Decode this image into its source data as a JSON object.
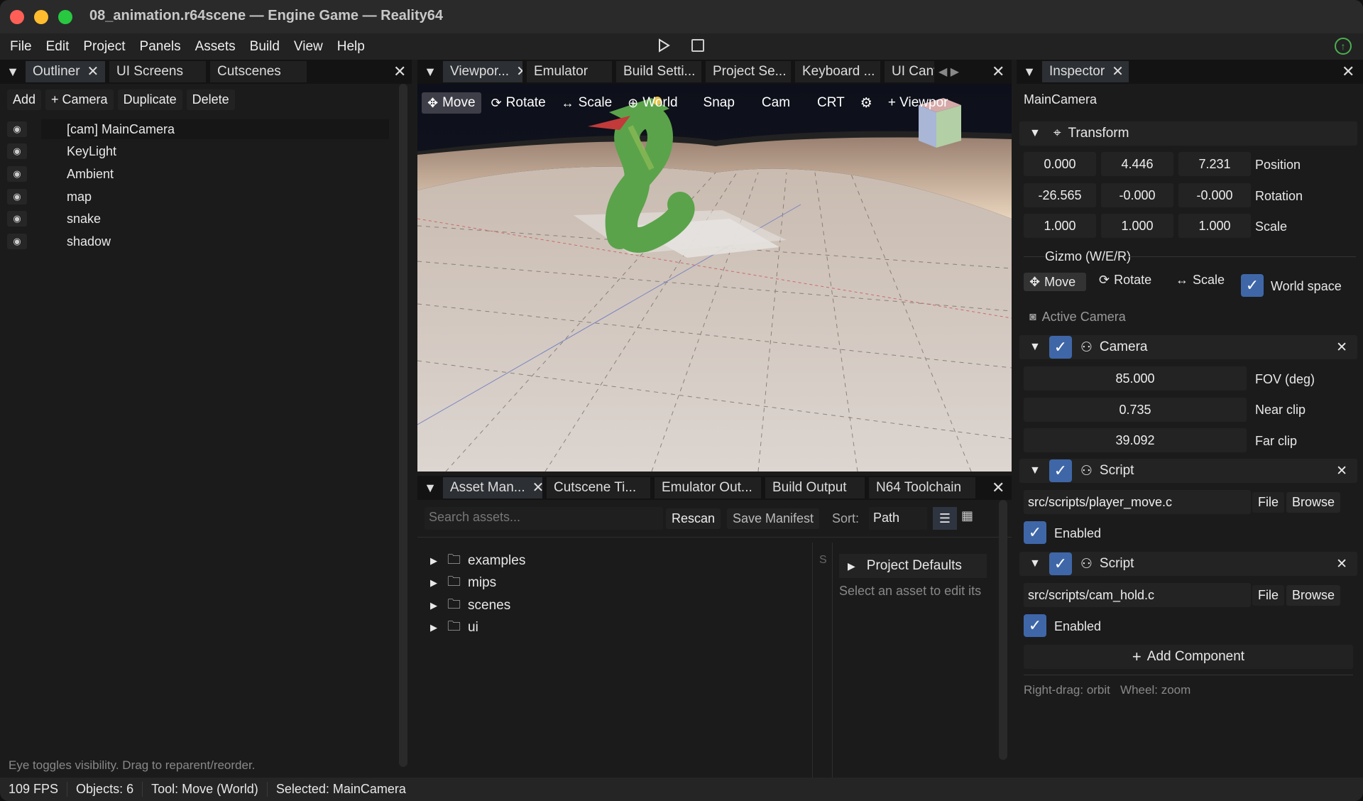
{
  "window": {
    "title": "08_animation.r64scene — Engine Game — Reality64"
  },
  "menu": [
    "File",
    "Edit",
    "Project",
    "Panels",
    "Assets",
    "Build",
    "View",
    "Help"
  ],
  "outliner": {
    "tabs": [
      "Outliner",
      "UI Screens",
      "Cutscenes"
    ],
    "toolbar": [
      "Add",
      "+ Camera",
      "Duplicate",
      "Delete"
    ],
    "items": [
      "[cam] MainCamera",
      "KeyLight",
      "Ambient",
      "map",
      "snake",
      "shadow"
    ],
    "hint": "Eye toggles visibility. Drag to reparent/reorder."
  },
  "viewport_tabs": [
    "Viewpor...",
    "Emulator",
    "Build Setti...",
    "Project Se...",
    "Keyboard ...",
    "UI Canv"
  ],
  "viewport_toolbar": {
    "move": "Move",
    "rotate": "Rotate",
    "scale": "Scale",
    "world": "World",
    "snap": "Snap",
    "cam": "Cam",
    "crt": "CRT",
    "add_viewport": "+ Viewpor"
  },
  "bottom_tabs": [
    "Asset Man...",
    "Cutscene Ti...",
    "Emulator Out...",
    "Build Output",
    "N64 Toolchain"
  ],
  "assets": {
    "search_placeholder": "Search assets...",
    "rescan": "Rescan",
    "save_manifest": "Save Manifest",
    "sort_label": "Sort:",
    "sort_value": "Path",
    "folders": [
      "examples",
      "mips",
      "scenes",
      "ui"
    ],
    "col_s": "S",
    "project_defaults": "Project Defaults",
    "select_hint": "Select an asset to edit its"
  },
  "inspector": {
    "tab": "Inspector",
    "object_name": "MainCamera",
    "transform_label": "Transform",
    "position": [
      "0.000",
      "4.446",
      "7.231"
    ],
    "rotation": [
      "-26.565",
      "-0.000",
      "-0.000"
    ],
    "scale": [
      "1.000",
      "1.000",
      "1.000"
    ],
    "position_label": "Position",
    "rotation_label": "Rotation",
    "scale_label": "Scale",
    "gizmo_label": "Gizmo (W/E/R)",
    "gizmo_move": "Move",
    "gizmo_rotate": "Rotate",
    "gizmo_scale": "Scale",
    "world_space": "World space",
    "active_camera": "Active Camera",
    "camera_label": "Camera",
    "fov": "85.000",
    "fov_label": "FOV (deg)",
    "near": "0.735",
    "near_label": "Near clip",
    "far": "39.092",
    "far_label": "Far clip",
    "script1_label": "Script",
    "script1_path": "src/scripts/player_move.c",
    "script2_label": "Script",
    "script2_path": "src/scripts/cam_hold.c",
    "file": "File",
    "browse": "Browse",
    "enabled": "Enabled",
    "add_component": "Add Component",
    "hint": "Right-drag: orbit   Wheel: zoom"
  },
  "status": [
    "109 FPS",
    "Objects: 6",
    "Tool: Move (World)",
    "Selected: MainCamera"
  ],
  "colors": {
    "accent": "#3f67a8",
    "bg": "#1b1b1b",
    "snake": "#5aa34a"
  }
}
